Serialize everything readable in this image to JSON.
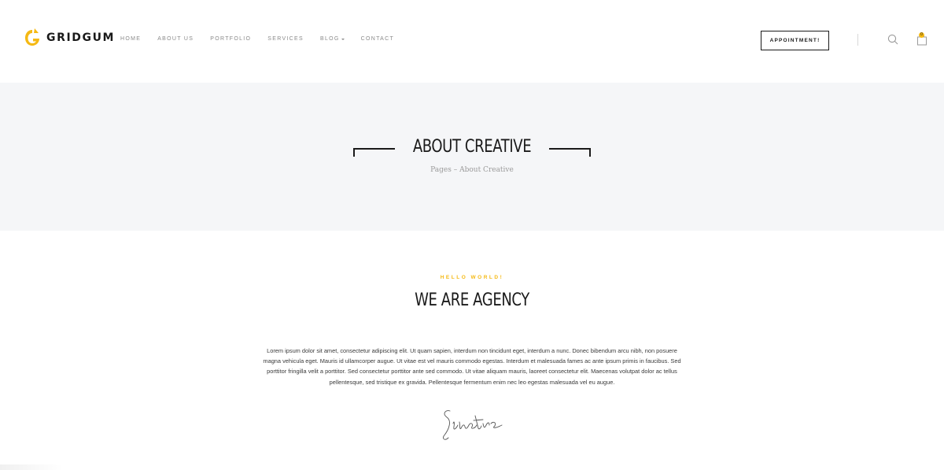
{
  "brand": {
    "name": "GRIDGUM",
    "accent_color": "#f5b914"
  },
  "nav": {
    "items": [
      {
        "label": "HOME"
      },
      {
        "label": "ABOUT US"
      },
      {
        "label": "PORTFOLIO"
      },
      {
        "label": "SERVICES"
      },
      {
        "label": "BLOG",
        "has_dropdown": true
      },
      {
        "label": "CONTACT"
      }
    ],
    "appointment_label": "APPOINTMENT!",
    "cart_count": "0"
  },
  "banner": {
    "title": "ABOUT CREATIVE",
    "breadcrumb": "Pages – About Creative"
  },
  "intro": {
    "eyebrow": "HELLO WORLD!",
    "title": "WE ARE AGENCY",
    "paragraph_lines": [
      "Lorem ipsum dolor sit amet, consectetur adipiscing elit. Ut quam sapien, interdum non tincidunt eget, interdum a nunc. Donec bibendum arcu nibh, non posuere",
      "magna vehicula eget. Mauris id ullamcorper augue. Ut vitae est vel mauris commodo egestas. Interdum et malesuada fames ac ante ipsum primis in faucibus. Sed",
      "porttitor fringilla velit a porttitor. Sed consectetur porttitor ante sed commodo. Ut vitae aliquam mauris, laoreet consectetur elit. Maecenas volutpat dolor ac tellus",
      "pellentesque, sed tristique ex gravida. Pellentesque fermentum enim nec leo egestas malesuada vel eu augue."
    ],
    "signature_text": "Sinatra"
  },
  "icons": {
    "search": "search-icon",
    "cart": "shopping-bag-icon",
    "logo": "logo-mark-icon"
  }
}
